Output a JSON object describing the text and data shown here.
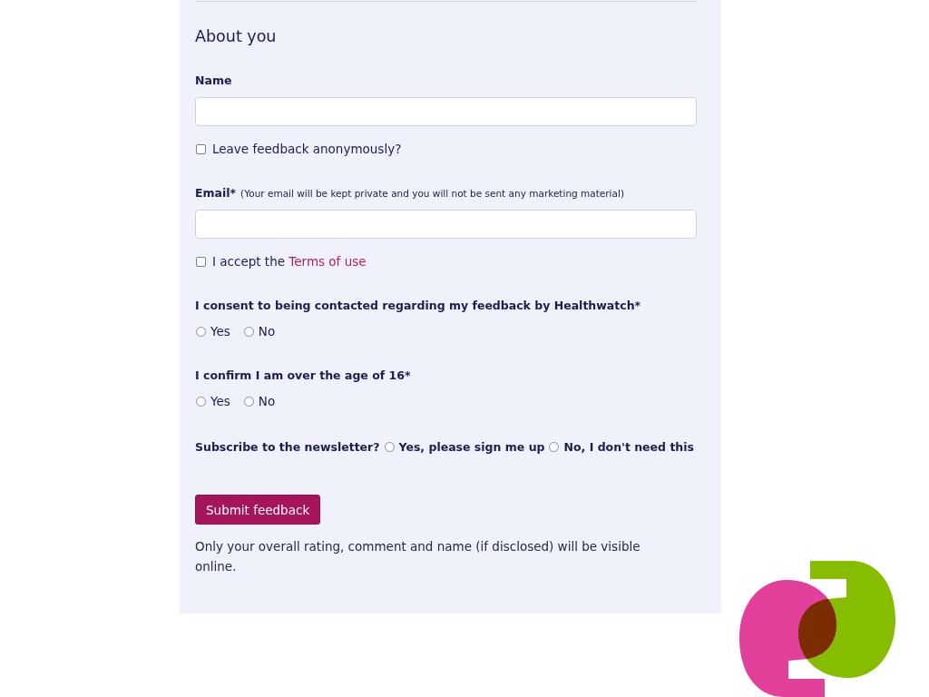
{
  "form": {
    "section": {
      "heading": "About you"
    },
    "name_field": {
      "label": "Name"
    },
    "anonymous_checkbox": {
      "label": "Leave feedback anonymously?",
      "checked": false
    },
    "email_field": {
      "label": "Email*",
      "note": "(Your email will be kept private and you will not be sent any marketing material)"
    },
    "terms_checkbox": {
      "label": "I accept the",
      "link": "Terms of use",
      "checked": false
    },
    "questions": [
      {
        "kind": "stacked",
        "label": "I consent to being contacted regarding my feedback by Healthwatch*",
        "options": [
          {
            "label": "Yes",
            "selected": false
          },
          {
            "label": "No",
            "selected": false
          }
        ]
      },
      {
        "kind": "stacked",
        "label": "I confirm I am over the age of 16*",
        "options": [
          {
            "label": "Yes",
            "selected": false
          },
          {
            "label": "No",
            "selected": false
          }
        ]
      },
      {
        "kind": "inline",
        "label": "Subscribe to the newsletter?",
        "options": [
          {
            "label": "Yes, please sign me up",
            "selected": false
          },
          {
            "label": "No, I don't need this",
            "selected": false
          }
        ]
      }
    ],
    "submit_button": {
      "label": "Submit feedback"
    },
    "footnote": "Only your overall rating, comment and name (if disclosed) will be visible online."
  }
}
